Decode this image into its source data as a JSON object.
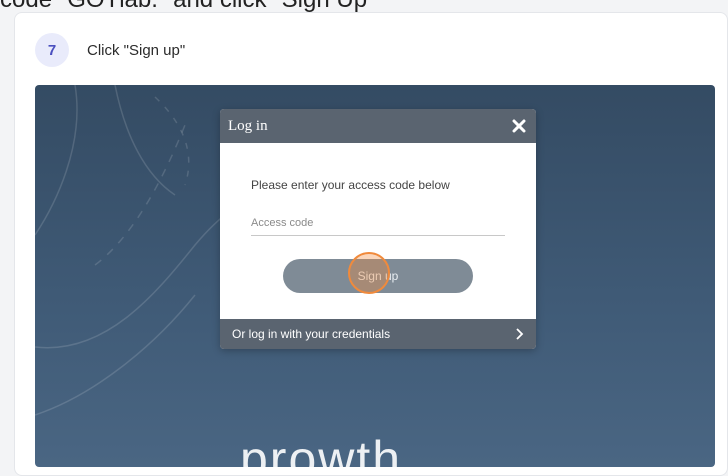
{
  "top_caption": "code \"GOTlab.\" and click \"Sign Up\"",
  "step": {
    "number": "7",
    "text": "Click \"Sign up\""
  },
  "modal": {
    "title": "Log in",
    "instruction": "Please enter your access code below",
    "access_code_placeholder": "Access code",
    "access_code_value": "",
    "signup_label": "Sign up",
    "credentials_link": "Or log in with your credentials"
  },
  "background_brand": "prowth",
  "colors": {
    "background_top": "#344b63",
    "background_bottom": "#4a6683",
    "modal_header": "#5a6470",
    "signup_button": "#7f8b96",
    "step_badge_bg": "#e9ebfb",
    "step_badge_text": "#4a4fbf",
    "click_highlight": "#f08a3c"
  },
  "icons": {
    "close": "close-icon",
    "chevron": "chevron-right-icon"
  }
}
